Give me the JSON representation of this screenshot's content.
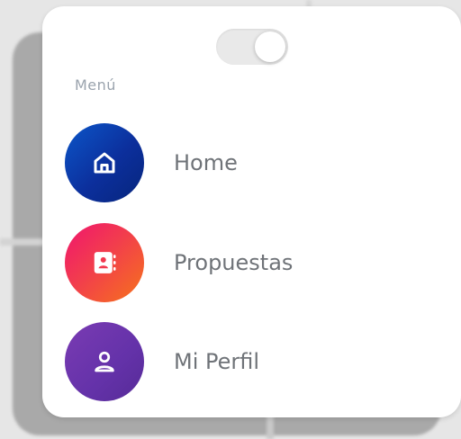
{
  "menu": {
    "heading": "Menú",
    "toggle": {
      "state": "on"
    },
    "items": [
      {
        "label": "Home",
        "icon": "home-icon",
        "color_from": "#0b56c9",
        "color_to": "#06257c"
      },
      {
        "label": "Propuestas",
        "icon": "contacts-book-icon",
        "color_from": "#f0156e",
        "color_to": "#f6731b"
      },
      {
        "label": "Mi Perfil",
        "icon": "user-icon",
        "color_from": "#7a3bb3",
        "color_to": "#562b97"
      }
    ]
  }
}
